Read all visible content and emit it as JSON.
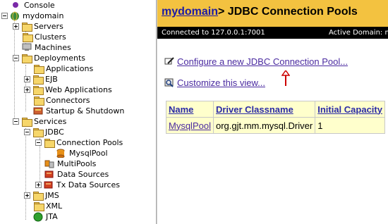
{
  "tree": {
    "console": "Console",
    "domain": "mydomain",
    "servers": "Servers",
    "clusters": "Clusters",
    "machines": "Machines",
    "deployments": "Deployments",
    "applications": "Applications",
    "ejb": "EJB",
    "web_applications": "Web Applications",
    "connectors": "Connectors",
    "startup_shutdown": "Startup & Shutdown",
    "services": "Services",
    "jdbc": "JDBC",
    "connection_pools": "Connection Pools",
    "mysqlpool": "MysqlPool",
    "multipools": "MultiPools",
    "data_sources": "Data Sources",
    "tx_data_sources": "Tx Data Sources",
    "jms": "JMS",
    "xml": "XML",
    "jta": "JTA"
  },
  "header": {
    "domain_link": "mydomain",
    "title_rest": "> JDBC Connection Pools"
  },
  "status": {
    "connected": "Connected to 127.0.0.1:7001",
    "active_domain": "Active Domain: my"
  },
  "actions": {
    "configure": "Configure a new JDBC Connection Pool...",
    "customize": "Customize this view..."
  },
  "table": {
    "headers": [
      "Name",
      "Driver Classname",
      "Initial Capacity"
    ],
    "rows": [
      [
        "MysqlPool",
        "org.gjt.mm.mysql.Driver",
        "1"
      ]
    ]
  },
  "colors": {
    "header_bg": "#f3c240",
    "table_bg": "#ffffcc",
    "annotation_arrow": "#cc0000"
  }
}
